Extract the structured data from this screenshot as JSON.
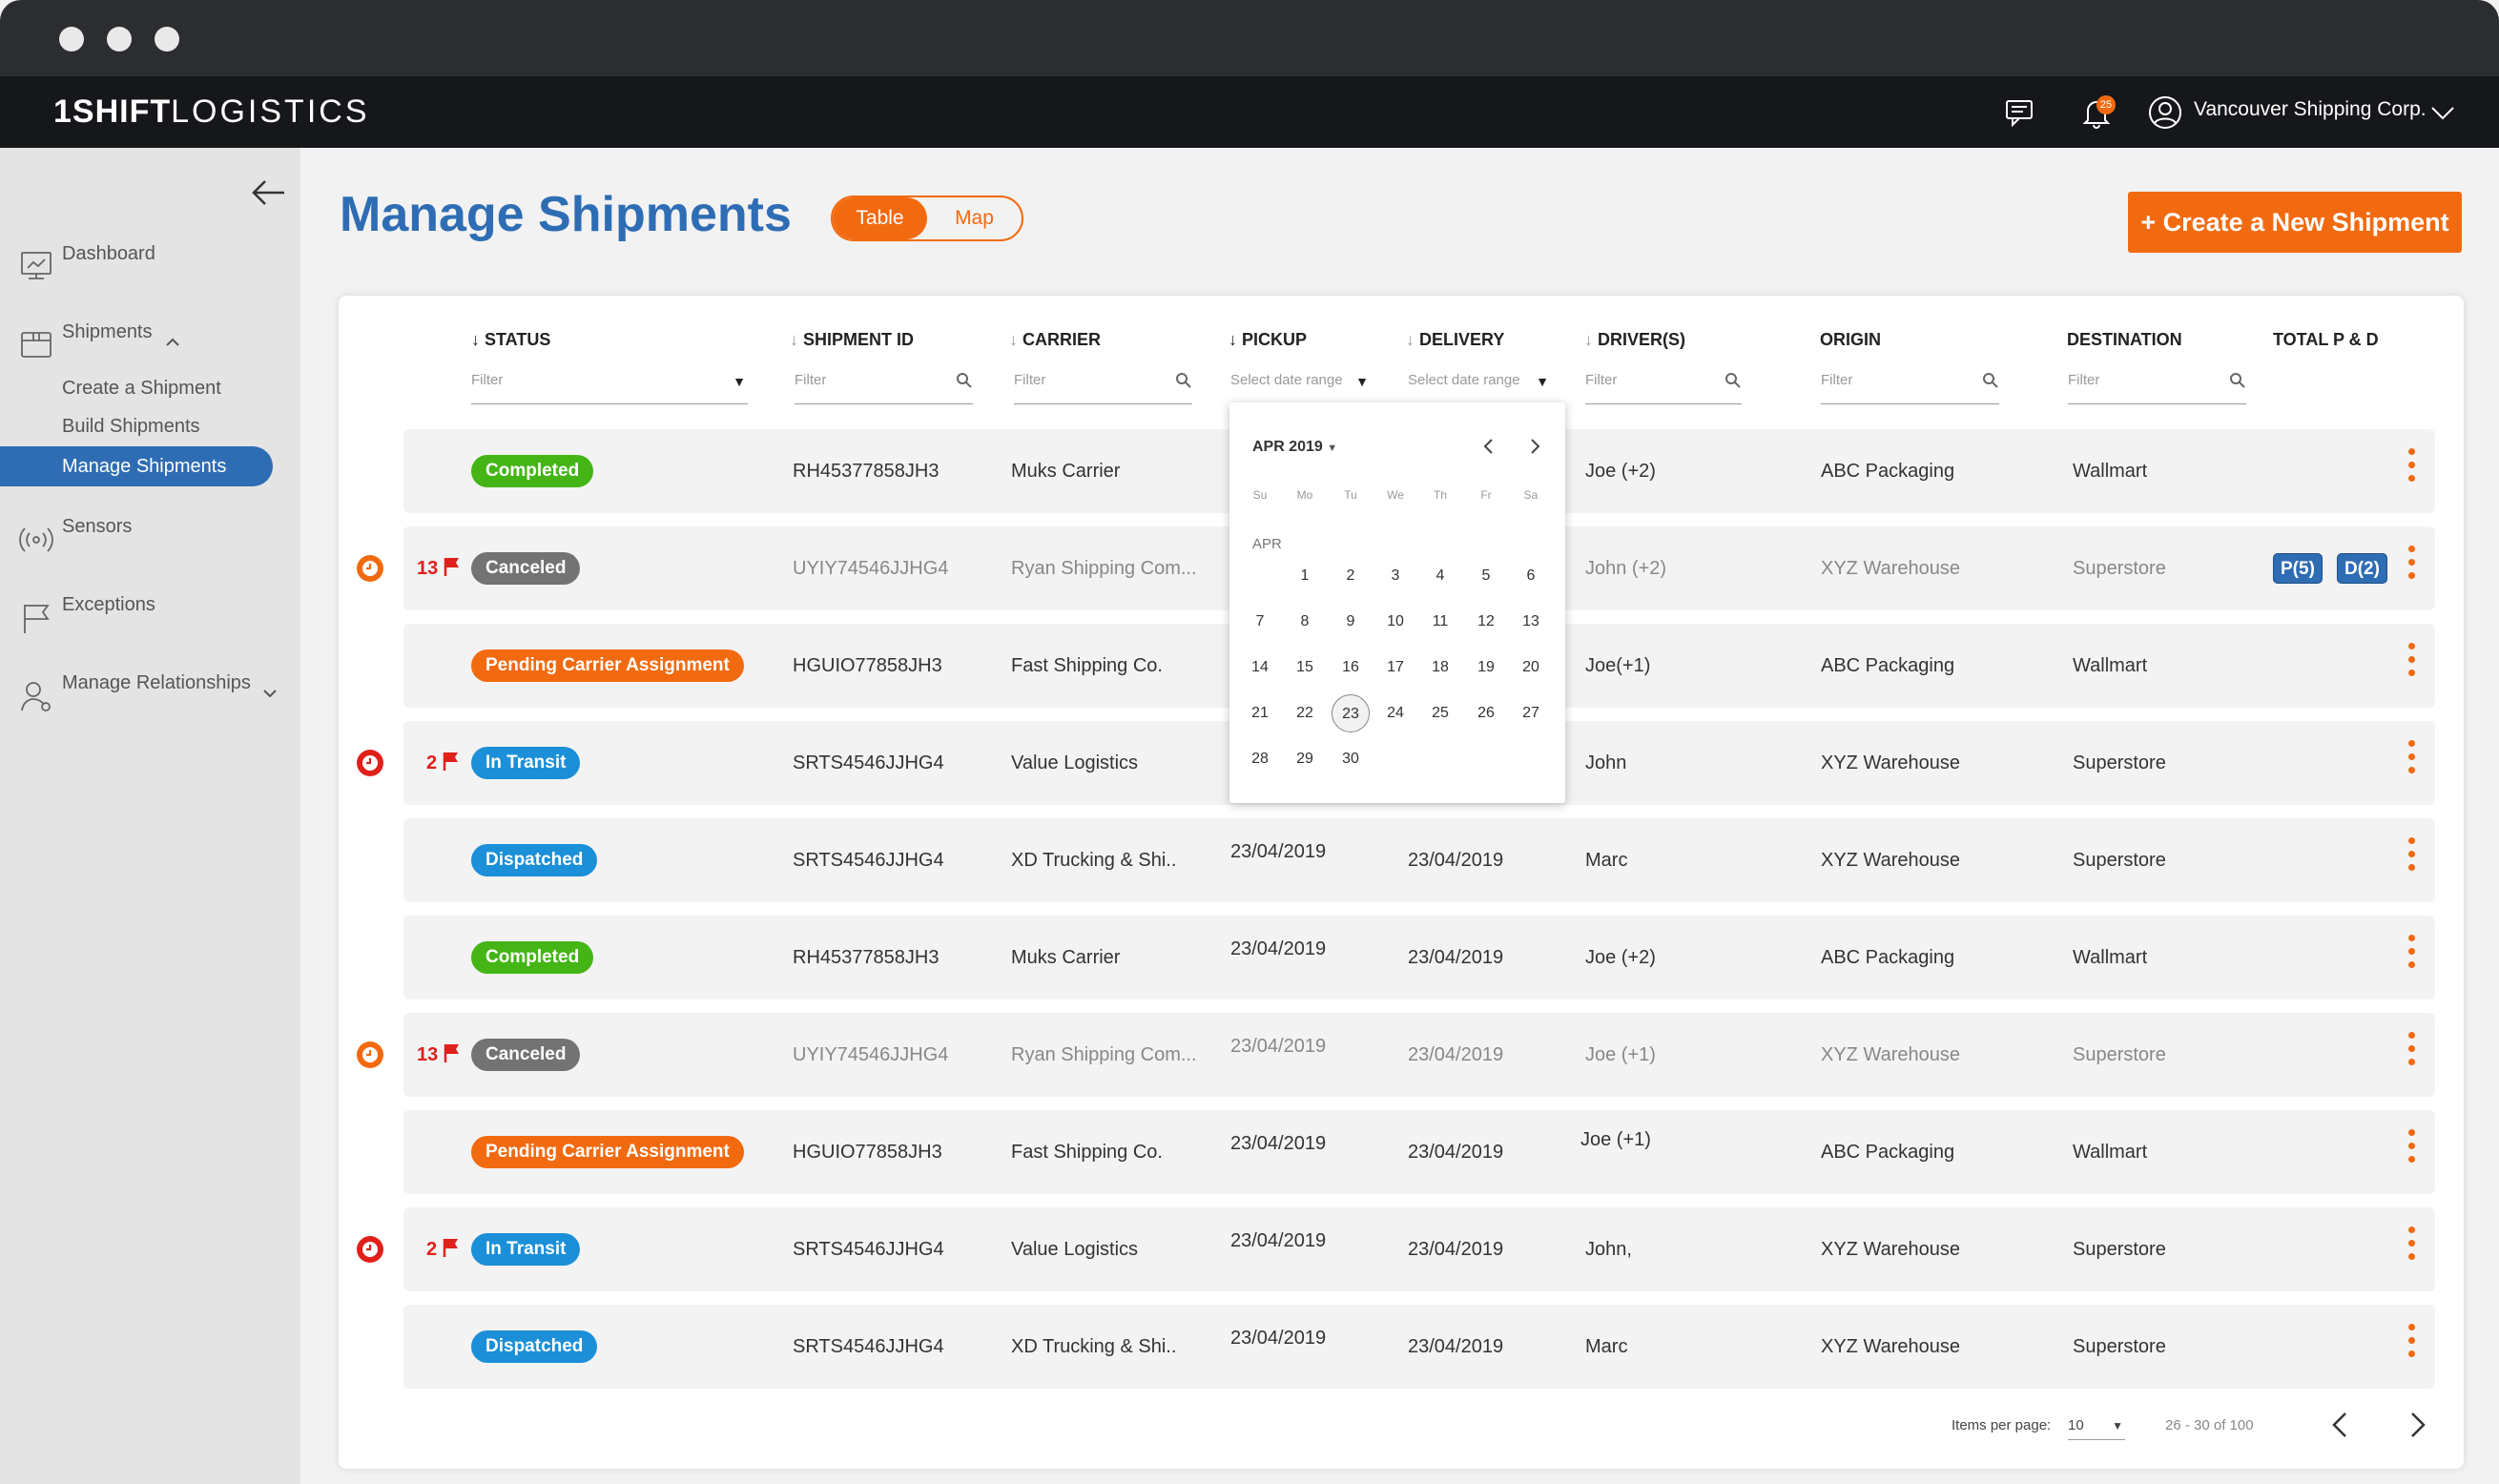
{
  "app": {
    "logo_bold": "1SHIFT",
    "logo_light": "LOGISTICS",
    "account": "Vancouver Shipping Corp.",
    "notification_count": "25"
  },
  "sidebar": {
    "dashboard": "Dashboard",
    "shipments": "Shipments",
    "create": "Create a Shipment",
    "build": "Build Shipments",
    "manage": "Manage Shipments",
    "sensors": "Sensors",
    "exceptions": "Exceptions",
    "relationships": "Manage Relationships"
  },
  "page": {
    "title": "Manage Shipments",
    "toggle_table": "Table",
    "toggle_map": "Map",
    "create_button": "+ Create a New Shipment"
  },
  "columns": {
    "status": "STATUS",
    "shipment_id": "SHIPMENT ID",
    "carrier": "CARRIER",
    "pickup": "PICKUP",
    "delivery": "DELIVERY",
    "drivers": "DRIVER(S)",
    "origin": "ORIGIN",
    "destination": "DESTINATION",
    "total": "TOTAL P & D"
  },
  "filters": {
    "filter": "Filter",
    "date_range": "Select date range"
  },
  "rows": [
    {
      "status": "Completed",
      "id": "RH45377858JH3",
      "carrier": "Muks Carrier",
      "pickup": "",
      "delivery": "",
      "driver": "Joe (+2)",
      "origin": "ABC Packaging",
      "dest": "Wallmart",
      "alert": "",
      "count": ""
    },
    {
      "status": "Canceled",
      "id": "UYIY74546JJHG4",
      "carrier": "Ryan Shipping Com...",
      "pickup": "",
      "delivery": "",
      "driver": "John (+2)",
      "origin": "XYZ Warehouse",
      "dest": "Superstore",
      "alert": "orange",
      "count": "13",
      "p": "P(5)",
      "d": "D(2)"
    },
    {
      "status": "Pending Carrier Assignment",
      "id": "HGUIO77858JH3",
      "carrier": "Fast Shipping Co.",
      "pickup": "",
      "delivery": "",
      "driver": "Joe(+1)",
      "origin": "ABC Packaging",
      "dest": "Wallmart",
      "alert": "",
      "count": ""
    },
    {
      "status": "In Transit",
      "id": "SRTS4546JJHG4",
      "carrier": "Value Logistics",
      "pickup": "",
      "delivery": "",
      "driver": "John",
      "origin": "XYZ Warehouse",
      "dest": "Superstore",
      "alert": "red",
      "count": "2"
    },
    {
      "status": "Dispatched",
      "id": "SRTS4546JJHG4",
      "carrier": "XD Trucking & Shi..",
      "pickup": "23/04/2019",
      "delivery": "23/04/2019",
      "driver": "Marc",
      "origin": "XYZ Warehouse",
      "dest": "Superstore",
      "alert": "",
      "count": ""
    },
    {
      "status": "Completed",
      "id": "RH45377858JH3",
      "carrier": "Muks Carrier",
      "pickup": "23/04/2019",
      "delivery": "23/04/2019",
      "driver": "Joe (+2)",
      "origin": "ABC Packaging",
      "dest": "Wallmart",
      "alert": "",
      "count": ""
    },
    {
      "status": "Canceled",
      "id": "UYIY74546JJHG4",
      "carrier": "Ryan Shipping Com...",
      "pickup": "23/04/2019",
      "delivery": "23/04/2019",
      "driver": "Joe (+1)",
      "origin": "XYZ Warehouse",
      "dest": "Superstore",
      "alert": "orange",
      "count": "13"
    },
    {
      "status": "Pending Carrier Assignment",
      "id": "HGUIO77858JH3",
      "carrier": "Fast Shipping Co.",
      "pickup": "23/04/2019",
      "delivery": "23/04/2019",
      "driver": "Joe (+1)",
      "origin": "ABC Packaging",
      "dest": "Wallmart",
      "alert": "",
      "count": ""
    },
    {
      "status": "In Transit",
      "id": "SRTS4546JJHG4",
      "carrier": "Value Logistics",
      "pickup": "23/04/2019",
      "delivery": "23/04/2019",
      "driver": "John,",
      "origin": "XYZ Warehouse",
      "dest": "Superstore",
      "alert": "red",
      "count": "2"
    },
    {
      "status": "Dispatched",
      "id": "SRTS4546JJHG4",
      "carrier": "XD Trucking & Shi..",
      "pickup": "23/04/2019",
      "delivery": "23/04/2019",
      "driver": "Marc",
      "origin": "XYZ Warehouse",
      "dest": "Superstore",
      "alert": "",
      "count": ""
    }
  ],
  "calendar": {
    "month_label": "APR 2019",
    "month_short": "APR",
    "weekdays": [
      "Su",
      "Mo",
      "Tu",
      "We",
      "Th",
      "Fr",
      "Sa"
    ],
    "days": [
      1,
      2,
      3,
      4,
      5,
      6,
      7,
      8,
      9,
      10,
      11,
      12,
      13,
      14,
      15,
      16,
      17,
      18,
      19,
      20,
      21,
      22,
      23,
      24,
      25,
      26,
      27,
      28,
      29,
      30
    ],
    "selected": 23
  },
  "pagination": {
    "items_label": "Items per page:",
    "items_value": "10",
    "range": "26 - 30 of 100"
  },
  "colors": {
    "brand_blue": "#2e6db4",
    "accent_orange": "#f26a10",
    "green": "#44b515",
    "grey": "#737373",
    "blue_status": "#1b8fd8",
    "alert_red": "#e0201b"
  }
}
